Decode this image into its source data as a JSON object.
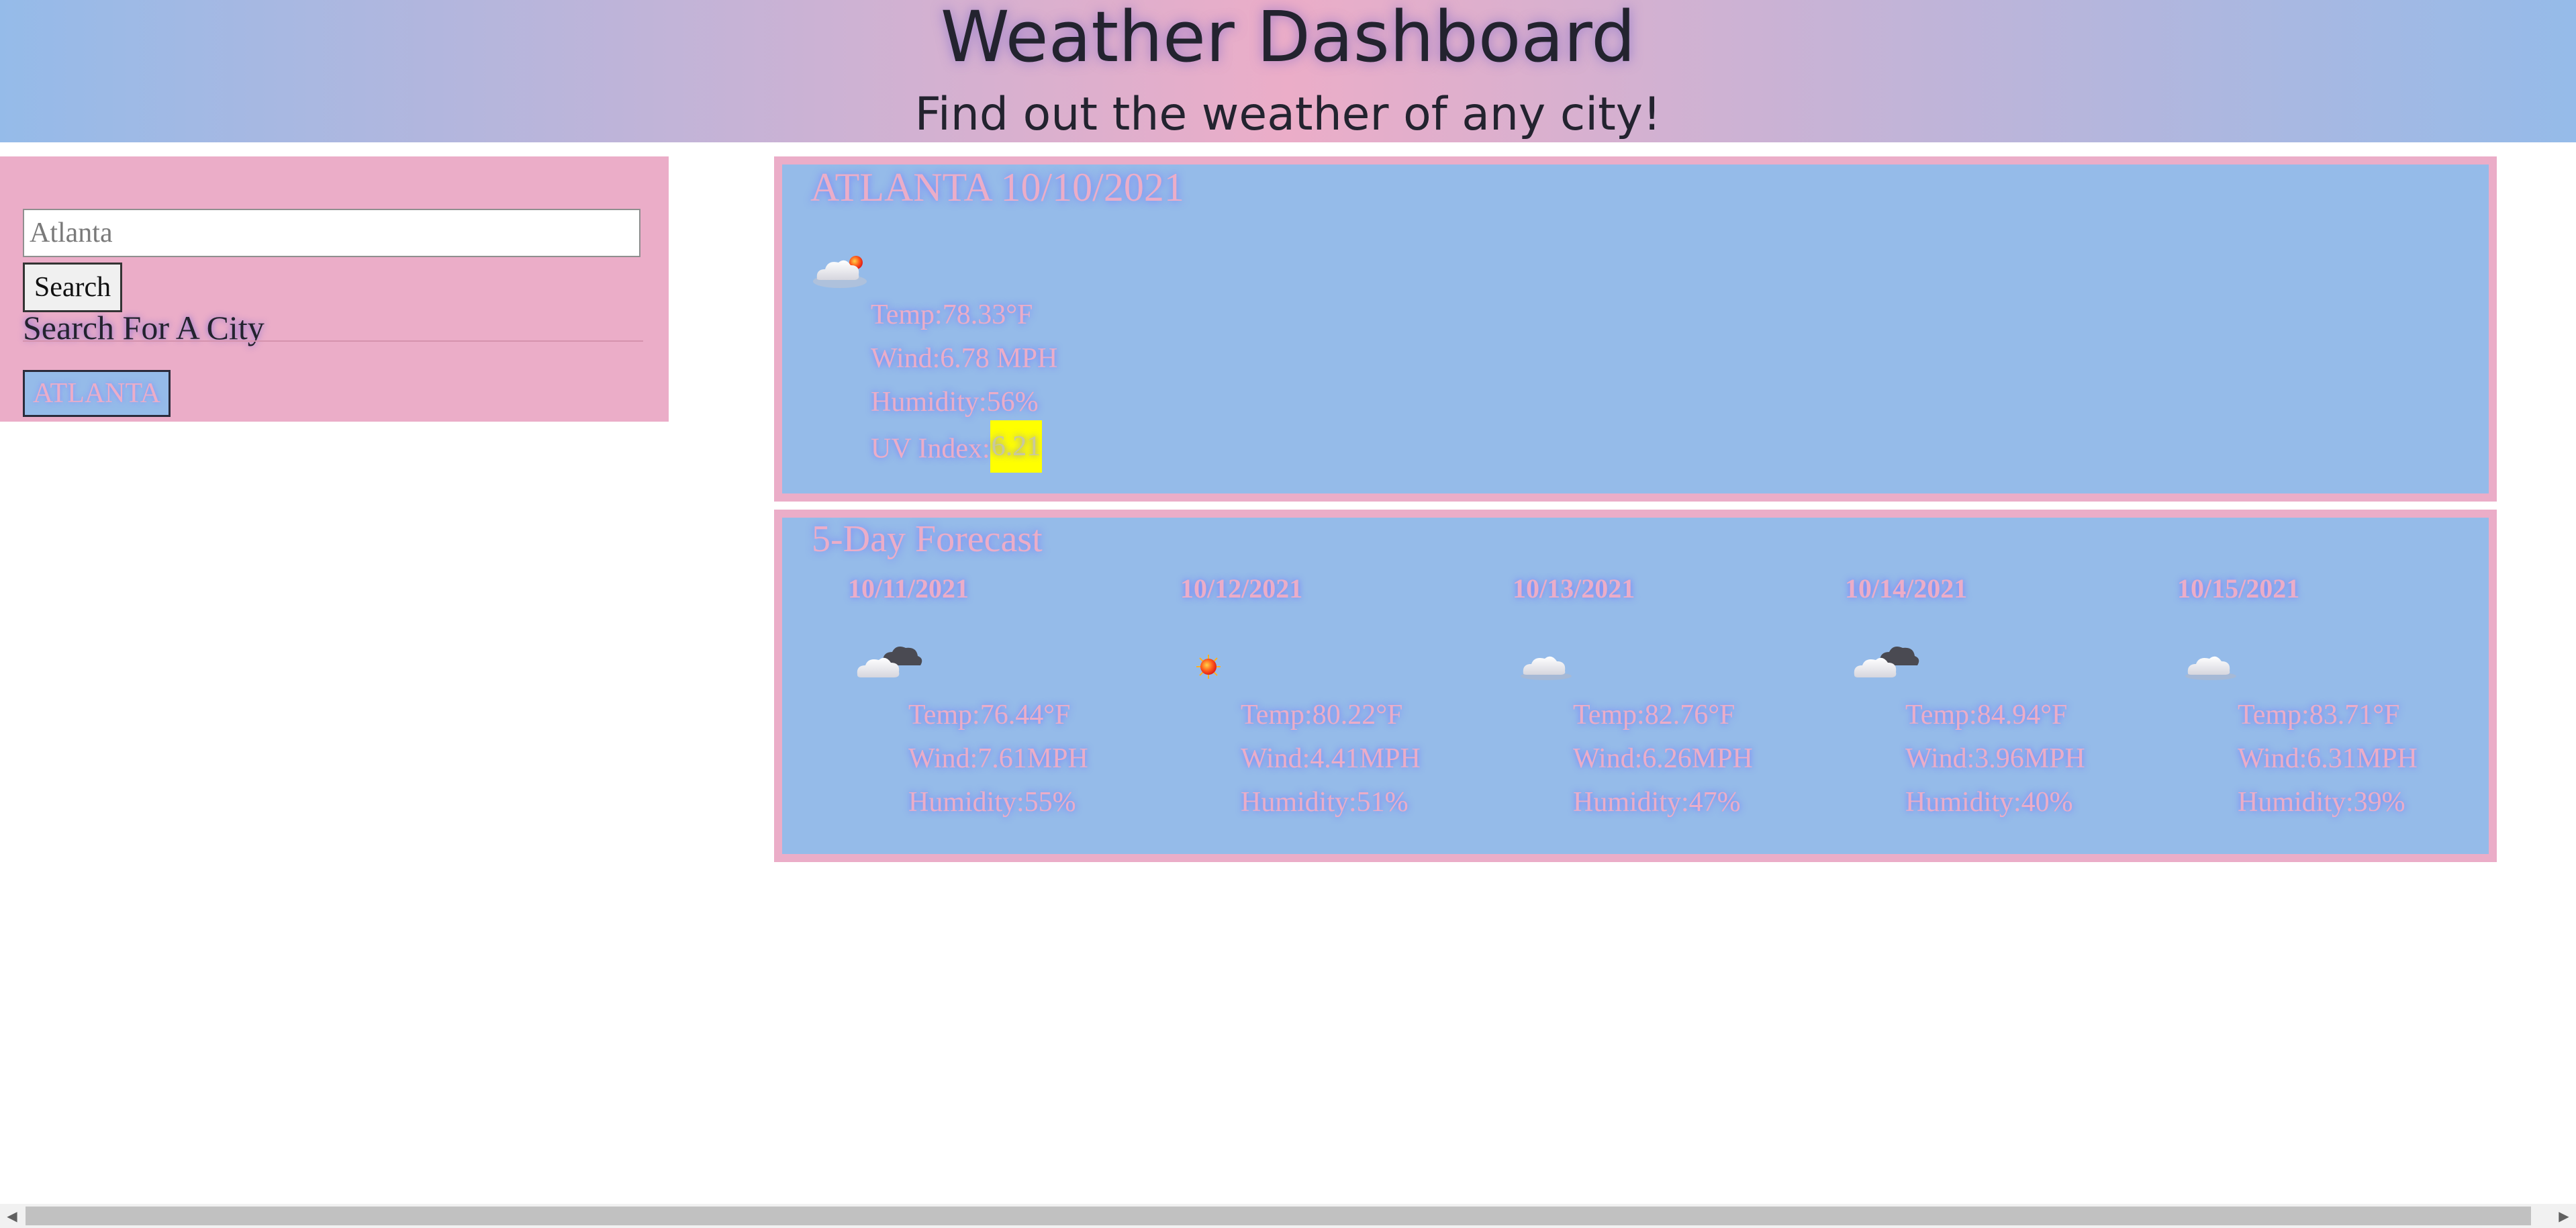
{
  "header": {
    "title": "Weather Dashboard",
    "subtitle": "Find out the weather of any city!"
  },
  "sidebar": {
    "heading": "Search For A City",
    "search_placeholder": "Atlanta",
    "search_value": "",
    "search_button": "Search",
    "history": [
      "ATLANTA"
    ]
  },
  "current": {
    "title": "ATLANTA 10/10/2021",
    "icon": "partly-cloudy-sun-icon",
    "temp": "Temp:78.33°F",
    "wind": "Wind:6.78 MPH",
    "humidity": "Humidity:56%",
    "uv_label": "UV Index:",
    "uv_value": "6.21",
    "uv_color": "#ffff00"
  },
  "forecast": {
    "title": "5-Day Forecast",
    "days": [
      {
        "date": "10/11/2021",
        "icon": "dark-cloud-icon",
        "temp": "Temp:76.44°F",
        "wind": "Wind:7.61MPH",
        "humidity": "Humidity:55%"
      },
      {
        "date": "10/12/2021",
        "icon": "sun-icon",
        "temp": "Temp:80.22°F",
        "wind": "Wind:4.41MPH",
        "humidity": "Humidity:51%"
      },
      {
        "date": "10/13/2021",
        "icon": "cloud-icon",
        "temp": "Temp:82.76°F",
        "wind": "Wind:6.26MPH",
        "humidity": "Humidity:47%"
      },
      {
        "date": "10/14/2021",
        "icon": "dark-cloud-icon",
        "temp": "Temp:84.94°F",
        "wind": "Wind:3.96MPH",
        "humidity": "Humidity:40%"
      },
      {
        "date": "10/15/2021",
        "icon": "cloud-icon",
        "temp": "Temp:83.71°F",
        "wind": "Wind:6.31MPH",
        "humidity": "Humidity:39%"
      }
    ]
  },
  "colors": {
    "pink": "#ebadc8",
    "blue": "#95bbe9",
    "text_dark": "#23232f"
  }
}
